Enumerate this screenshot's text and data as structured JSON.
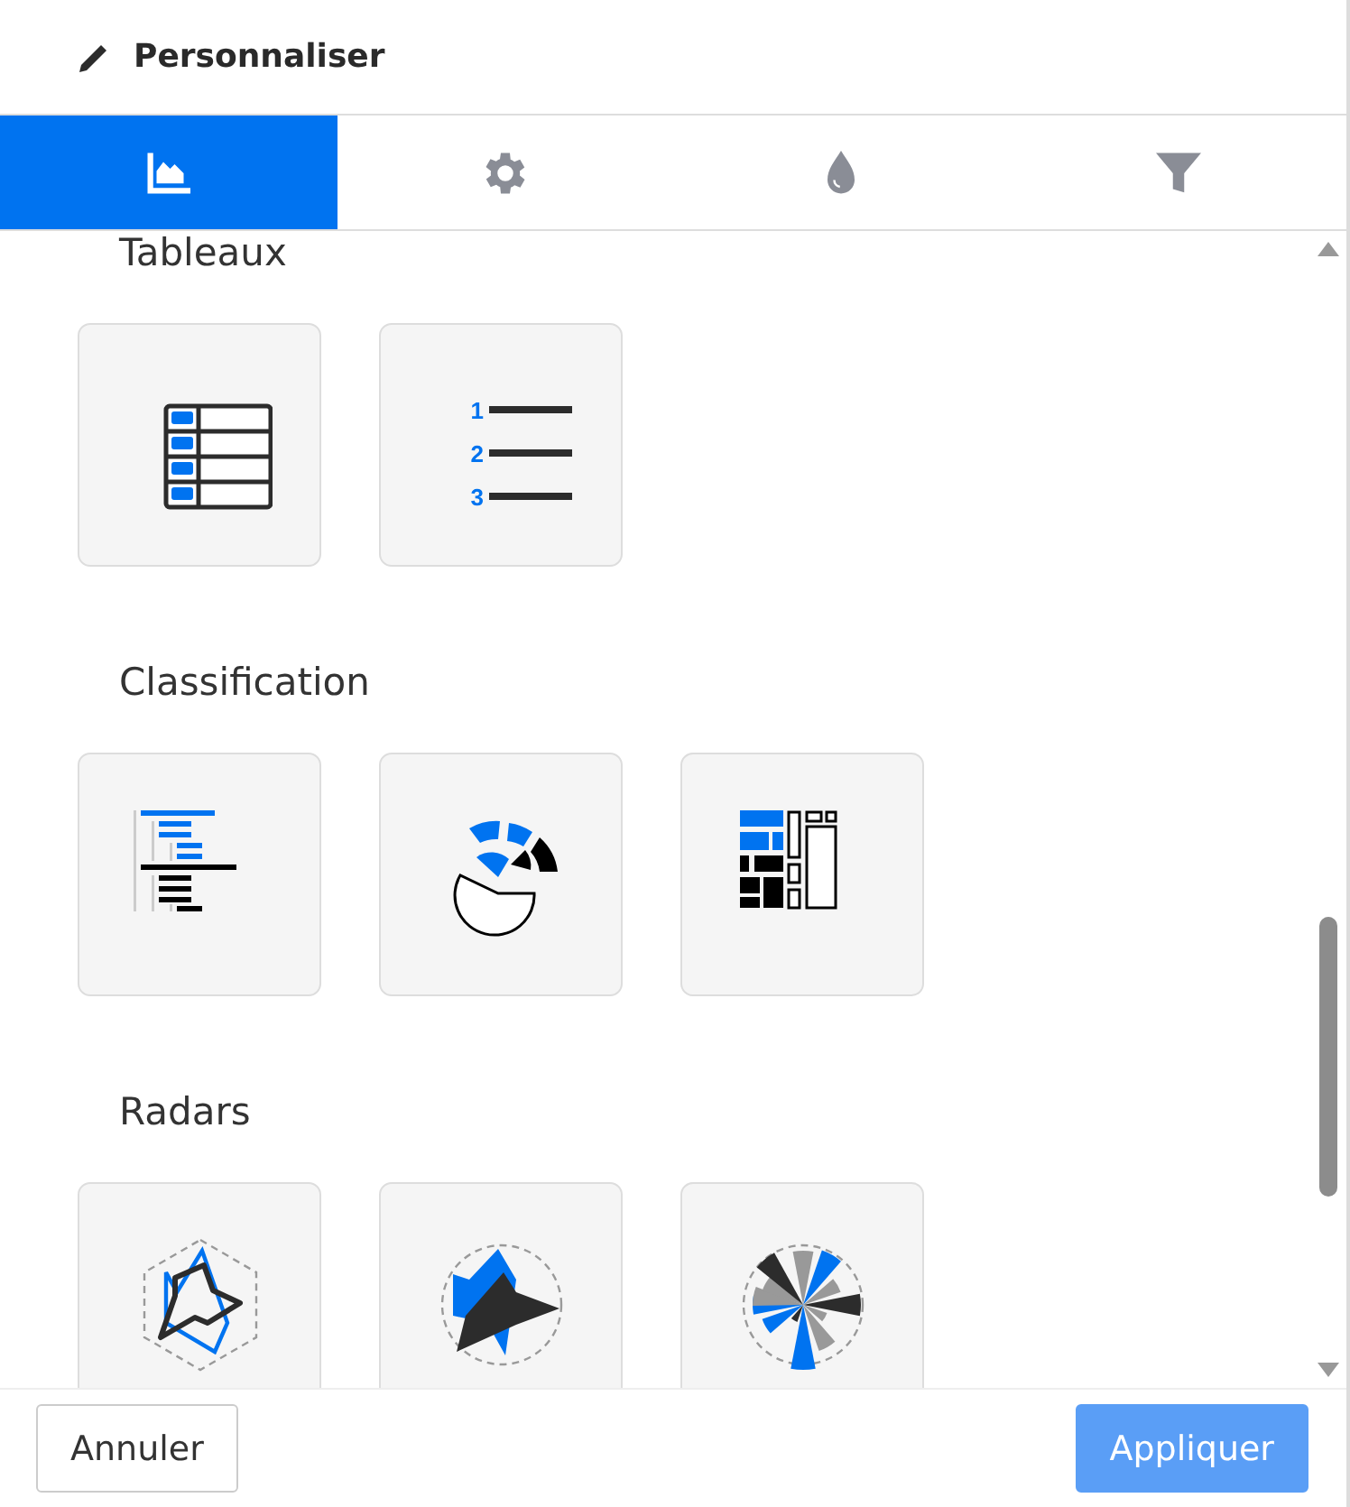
{
  "header": {
    "title": "Personnaliser"
  },
  "tabs": [
    {
      "kind": "chart",
      "selected": true
    },
    {
      "kind": "settings",
      "selected": false
    },
    {
      "kind": "color",
      "selected": false
    },
    {
      "kind": "filter",
      "selected": false
    }
  ],
  "sections": [
    {
      "title": "Tableaux",
      "cards": [
        {
          "kind": "table"
        },
        {
          "kind": "ranked-list",
          "labels": [
            "1",
            "2",
            "3"
          ]
        }
      ]
    },
    {
      "title": "Classification",
      "cards": [
        {
          "kind": "tree-bars"
        },
        {
          "kind": "sunburst"
        },
        {
          "kind": "treemap"
        }
      ]
    },
    {
      "title": "Radars",
      "cards": [
        {
          "kind": "radar-line"
        },
        {
          "kind": "radar-area"
        },
        {
          "kind": "polar-bars"
        }
      ]
    }
  ],
  "footer": {
    "cancel": "Annuler",
    "apply": "Appliquer"
  }
}
